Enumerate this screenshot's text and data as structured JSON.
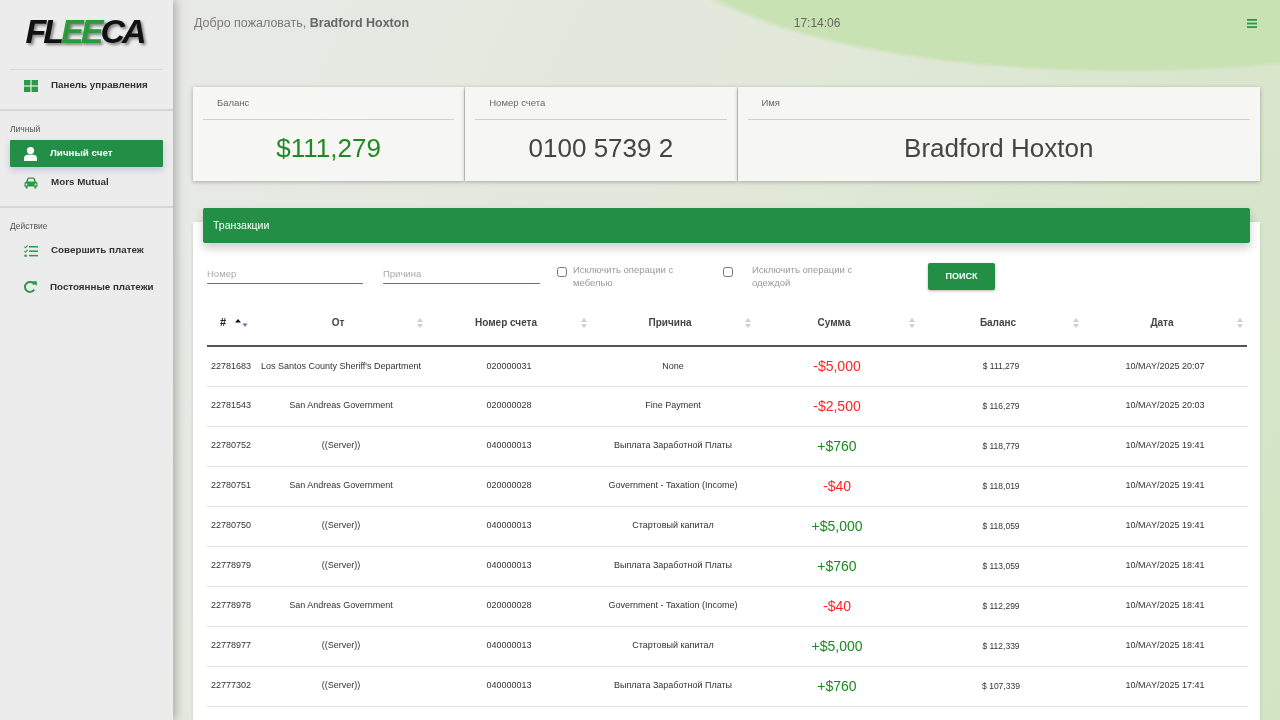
{
  "sidebar": {
    "logo": [
      {
        "text": "FL",
        "accent": false
      },
      {
        "text": "EE",
        "accent": true
      },
      {
        "text": "CA",
        "accent": false
      }
    ],
    "groups": [
      {
        "items": [
          {
            "label": "Панель управления",
            "selected": false
          }
        ]
      },
      {
        "heading": "Личный",
        "items": [
          {
            "label": "Личный счет",
            "selected": true
          },
          {
            "label": "Mors Mutual",
            "selected": false
          }
        ]
      },
      {
        "heading": "Действие",
        "items": [
          {
            "label": "Совершить платеж",
            "selected": false
          },
          {
            "label": "Постоянные платежи",
            "selected": false
          }
        ]
      }
    ]
  },
  "topbar": {
    "greeting": "Добро пожаловать, **Bradford Hoxton**",
    "time": "17:14:06"
  },
  "summary": [
    {
      "label": "Баланс",
      "value": "$111,279",
      "kind": "money"
    },
    {
      "label": "Номер счета",
      "value": "0100 5739 2",
      "kind": "text"
    },
    {
      "label": "Имя",
      "value": "Bradford Hoxton",
      "kind": "text"
    }
  ],
  "transactions": {
    "title": "Транзакции",
    "filters": [
      {
        "kind": "text",
        "placeholder": "Номер"
      },
      {
        "kind": "text",
        "placeholder": "Причина"
      },
      {
        "kind": "checkbox",
        "label": "Исключить операции с мебелью",
        "checked": false
      },
      {
        "kind": "checkbox",
        "label": "Исключить операции с одеждой",
        "checked": false
      }
    ],
    "search_button": "ПОИСК",
    "columns": [
      {
        "label": "#",
        "sorted": true
      },
      {
        "label": "От",
        "sorted": false
      },
      {
        "label": "Номер счета",
        "sorted": false
      },
      {
        "label": "Причина",
        "sorted": false
      },
      {
        "label": "Сумма",
        "sorted": false
      },
      {
        "label": "Баланс",
        "sorted": false
      },
      {
        "label": "Дата",
        "sorted": false
      }
    ],
    "rows": [
      {
        "kind": "debit",
        "cells": [
          "22781683",
          "Los Santos County Sheriff's Department",
          "020000031",
          "None",
          "-$5,000",
          "$ 111,279",
          "10/MAY/2025 20:07"
        ]
      },
      {
        "kind": "debit",
        "cells": [
          "22781543",
          "San Andreas Government",
          "020000028",
          "Fine Payment",
          "-$2,500",
          "$ 116,279",
          "10/MAY/2025 20:03"
        ]
      },
      {
        "kind": "credit",
        "cells": [
          "22780752",
          "((Server))",
          "040000013",
          "Выплата Заработной Платы",
          "+$760",
          "$ 118,779",
          "10/MAY/2025 19:41"
        ]
      },
      {
        "kind": "debit",
        "cells": [
          "22780751",
          "San Andreas Government",
          "020000028",
          "Government - Taxation (Income)",
          "-$40",
          "$ 118,019",
          "10/MAY/2025 19:41"
        ]
      },
      {
        "kind": "credit",
        "cells": [
          "22780750",
          "((Server))",
          "040000013",
          "Стартовый капитал",
          "+$5,000",
          "$ 118,059",
          "10/MAY/2025 19:41"
        ]
      },
      {
        "kind": "credit",
        "cells": [
          "22778979",
          "((Server))",
          "040000013",
          "Выплата Заработной Платы",
          "+$760",
          "$ 113,059",
          "10/MAY/2025 18:41"
        ]
      },
      {
        "kind": "debit",
        "cells": [
          "22778978",
          "San Andreas Government",
          "020000028",
          "Government - Taxation (Income)",
          "-$40",
          "$ 112,299",
          "10/MAY/2025 18:41"
        ]
      },
      {
        "kind": "credit",
        "cells": [
          "22778977",
          "((Server))",
          "040000013",
          "Стартовый капитал",
          "+$5,000",
          "$ 112,339",
          "10/MAY/2025 18:41"
        ]
      },
      {
        "kind": "credit",
        "cells": [
          "22777302",
          "((Server))",
          "040000013",
          "Выплата Заработной Платы",
          "+$760",
          "$ 107,339",
          "10/MAY/2025 17:41"
        ]
      }
    ]
  }
}
